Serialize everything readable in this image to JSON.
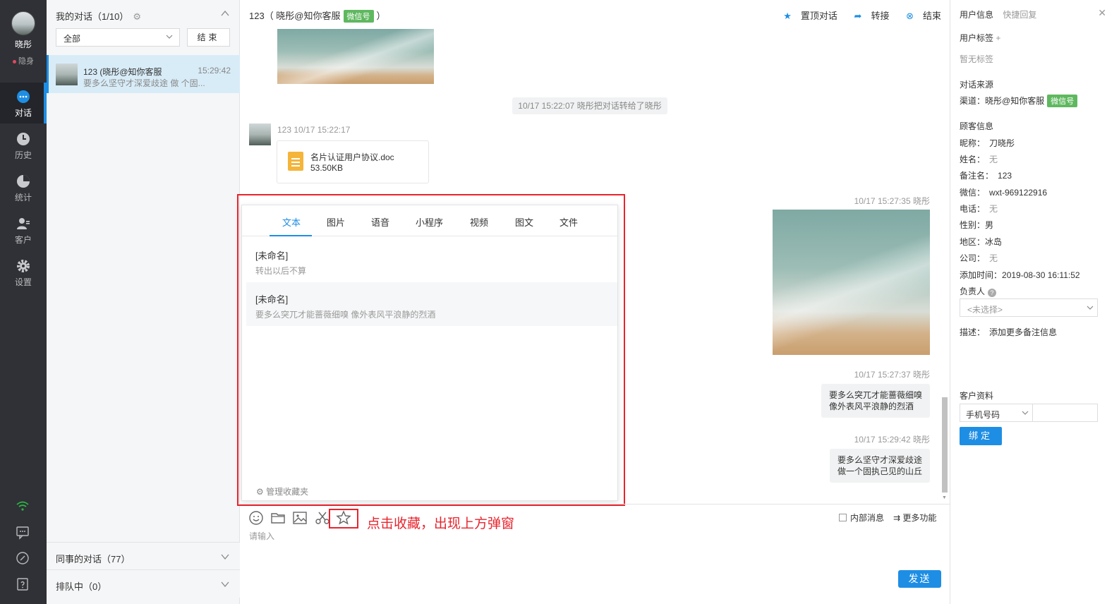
{
  "nav": {
    "user_name": "晓彤",
    "user_status": "隐身",
    "items": [
      {
        "label": "对话",
        "icon": "chat-icon"
      },
      {
        "label": "历史",
        "icon": "clock-icon"
      },
      {
        "label": "统计",
        "icon": "pie-chart-icon"
      },
      {
        "label": "客户",
        "icon": "customer-icon"
      },
      {
        "label": "设置",
        "icon": "gear-icon"
      }
    ]
  },
  "list": {
    "header": "我的对话（1/10）",
    "filter_value": "全部",
    "end_label": "结束",
    "conversation": {
      "name": "123 (晓彤@知你客服",
      "time": "15:29:42",
      "preview": "要多么坚守才深爱歧途 做  个固..."
    },
    "colleagues": "同事的对话（77）",
    "queue": "排队中（0）"
  },
  "chat": {
    "title_prefix": "123（ 晓彤@知你客服",
    "channel_tag": "微信号",
    "title_suffix": "）",
    "actions": {
      "pin": "置顶对话",
      "transfer": "转接",
      "end": "结束"
    },
    "system_message": "10/17 15:22:07 晓彤把对话转给了晓彤",
    "left_meta": "123 10/17 15:22:17",
    "file": {
      "name": "名片认证用户协议.doc",
      "size": "53.50KB"
    },
    "right_msgs": [
      {
        "meta": "10/17 15:27:35 晓彤"
      },
      {
        "meta": "10/17 15:27:37 晓彤",
        "text1": "要多么突兀才能蔷薇细嗅",
        "text2": "像外表风平浪静的烈酒"
      },
      {
        "meta": "10/17 15:29:42 晓彤",
        "text1": "要多么坚守才深爱歧途",
        "text2": "做一个固执己见的山丘"
      }
    ]
  },
  "popup": {
    "tabs": [
      "文本",
      "图片",
      "语音",
      "小程序",
      "视频",
      "图文",
      "文件"
    ],
    "active_tab": "文本",
    "items": [
      {
        "title": "[未命名]",
        "desc": "转出以后不算"
      },
      {
        "title": "[未命名]",
        "desc": "要多么突兀才能蔷薇细嗅 像外表风平浪静的烈酒"
      }
    ],
    "manage": "管理收藏夹"
  },
  "input": {
    "annotation": "点击收藏，出现上方弹窗",
    "placeholder": "请输入",
    "internal_msg": "内部消息",
    "more": "更多功能",
    "send": "发送"
  },
  "info": {
    "tab_user": "用户信息",
    "tab_quick": "快捷回复",
    "tag_label": "用户标签",
    "tag_none": "暂无标签",
    "source_label": "对话来源",
    "channel_label": "渠道：",
    "channel_value": "晓彤@知你客服",
    "channel_tag": "微信号",
    "customer_label": "顾客信息",
    "fields": [
      {
        "k": "昵称：",
        "v": "刀晓彤",
        "none": false
      },
      {
        "k": "姓名：",
        "v": "无",
        "none": true
      },
      {
        "k": "备注名：",
        "v": "123",
        "none": false
      },
      {
        "k": "微信：",
        "v": "wxt-969122916",
        "none": false
      },
      {
        "k": "电话：",
        "v": "无",
        "none": true
      },
      {
        "k": "性别：",
        "v": "男",
        "none": false
      },
      {
        "k": "地区：",
        "v": "冰岛",
        "none": false
      },
      {
        "k": "公司：",
        "v": "无",
        "none": true
      },
      {
        "k": "添加时间：",
        "v": "2019-08-30 16:11:52",
        "none": false
      }
    ],
    "owner_label": "负责人",
    "owner_placeholder": "<未选择>",
    "desc_label": "描述：",
    "desc_placeholder": "添加更多备注信息",
    "profile_label": "客户资料",
    "phone_option": "手机号码",
    "bind": "绑定"
  },
  "colors": {
    "accent": "#1e8ee4",
    "wechat": "#5fb85f",
    "annotation": "#e8242d",
    "nav_bg": "#2f3136"
  }
}
